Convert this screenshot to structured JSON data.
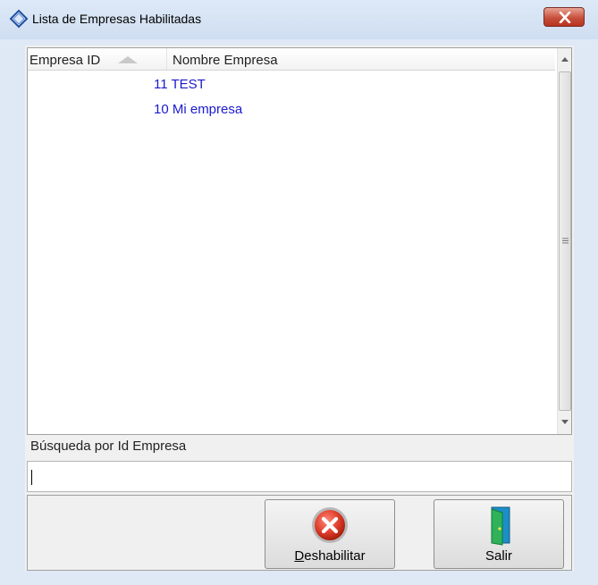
{
  "window": {
    "title": "Lista de Empresas Habilitadas"
  },
  "list": {
    "columns": [
      {
        "label": "Empresa ID",
        "sorted": "ascending"
      },
      {
        "label": "Nombre Empresa"
      }
    ],
    "rows": [
      {
        "text": "11 TEST"
      },
      {
        "text": "10 Mi empresa"
      }
    ]
  },
  "search": {
    "label": "Búsqueda por Id Empresa",
    "value": ""
  },
  "buttons": {
    "disable": {
      "mnemonic": "D",
      "rest": "eshabilitar",
      "icon": "cancel-x-icon"
    },
    "exit": {
      "label": "Salir",
      "icon": "exit-door-icon"
    }
  },
  "colors": {
    "row_text": "#1a1ad0",
    "titlebar": "#cfdef1",
    "close_button": "#c7503c"
  }
}
